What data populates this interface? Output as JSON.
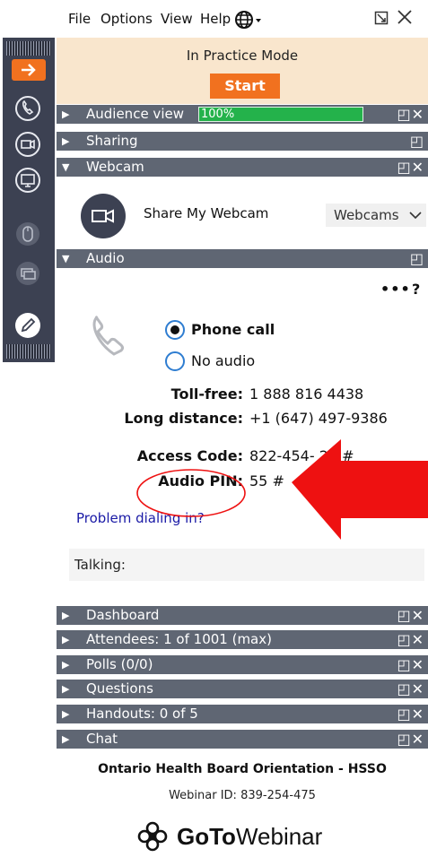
{
  "menu": {
    "file": "File",
    "options": "Options",
    "view": "View",
    "help": "Help"
  },
  "practice": {
    "mode_text": "In Practice Mode",
    "start_label": "Start"
  },
  "bars": {
    "audience_view": "Audience view",
    "audience_percent": "100%",
    "sharing": "Sharing",
    "webcam": "Webcam",
    "audio": "Audio",
    "dashboard": "Dashboard",
    "attendees": "Attendees:  1 of 1001 (max)",
    "polls": "Polls (0/0)",
    "questions": "Questions",
    "handouts": "Handouts: 0 of 5",
    "chat": "Chat"
  },
  "webcam": {
    "share_label": "Share My Webcam",
    "dropdown_label": "Webcams"
  },
  "audio": {
    "more": "•••",
    "help": "?",
    "phone_call": "Phone call",
    "no_audio": "No audio",
    "toll_free_label": "Toll-free:",
    "toll_free_value": "1 888 816 4438",
    "long_distance_label": "Long distance:",
    "long_distance_value": "+1 (647) 497-9386",
    "access_code_label": "Access Code:",
    "access_code_value": "822-454-  26 #",
    "audio_pin_label": "Audio PIN:",
    "audio_pin_value": "55 #",
    "problem_link": "Problem dialing in?",
    "talking_label": "Talking:"
  },
  "footer": {
    "title": "Ontario Health Board Orientation - HSSO",
    "webinar_id": "Webinar ID: 839-254-475",
    "logo_goto": "GoTo",
    "logo_webinar": "Webinar"
  },
  "colors": {
    "accent_orange": "#f1711f",
    "bar_gray": "#5f6673",
    "toolbar_dark": "#3c4152",
    "practice_bg": "#f9e6cd",
    "progress_green": "#24b24b",
    "link_blue": "#1a1aa6",
    "annotation_red": "#ee1111"
  },
  "icons": [
    "arrow-right-icon",
    "phone-icon",
    "camera-icon",
    "screen-icon",
    "mouse-icon",
    "chat-icon",
    "pencil-icon",
    "globe-icon",
    "popout-icon",
    "close-icon",
    "logo-flower-icon"
  ]
}
